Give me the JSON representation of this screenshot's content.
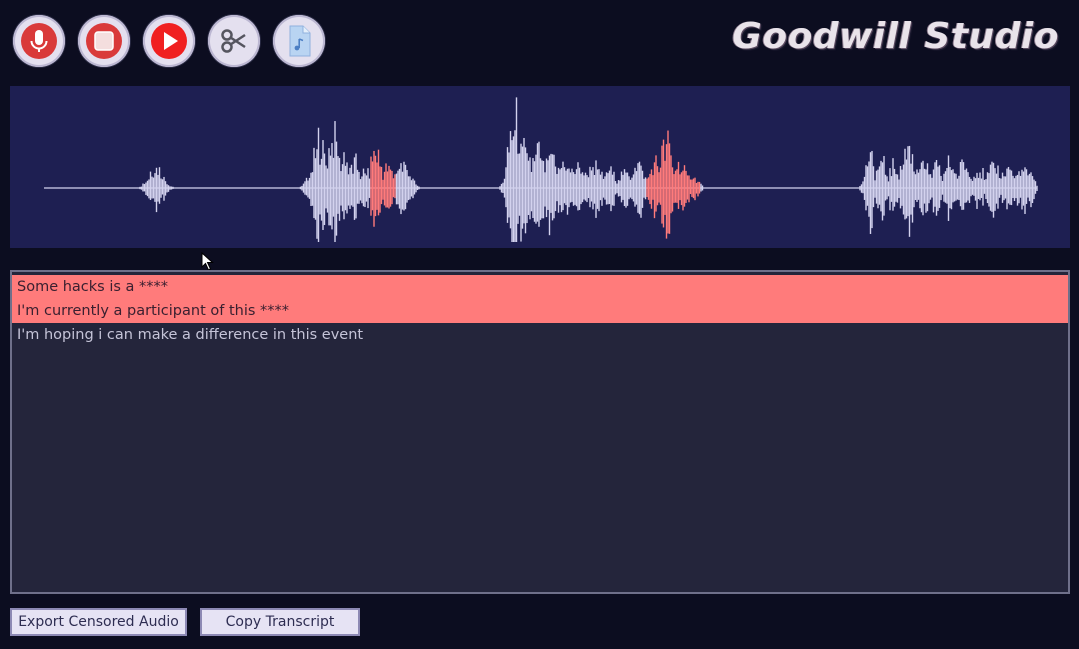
{
  "app": {
    "logo_text": "Goodwill Studio"
  },
  "toolbar": {
    "buttons": [
      {
        "name": "record",
        "icon": "microphone-icon",
        "color": "#d93a3a"
      },
      {
        "name": "stop",
        "icon": "stop-icon",
        "color": "#d93a3a"
      },
      {
        "name": "play",
        "icon": "play-icon",
        "color": "#f02020"
      },
      {
        "name": "cut",
        "icon": "scissors-icon",
        "color": "#6a6a78"
      },
      {
        "name": "file",
        "icon": "audio-file-icon",
        "color": "#a9c8ec"
      }
    ]
  },
  "waveform": {
    "base_color": "#d3d2ee",
    "censored_color": "#ff7b7b",
    "background": "#1e1f52"
  },
  "transcript": {
    "lines": [
      {
        "text": "Some hacks is a ****",
        "censored": true
      },
      {
        "text": "I'm currently a participant of this ****",
        "censored": true
      },
      {
        "text": "I'm hoping i can make a difference in this event",
        "censored": false
      }
    ]
  },
  "actions": {
    "export_label": "Export Censored Audio",
    "copy_label": "Copy Transcript"
  }
}
